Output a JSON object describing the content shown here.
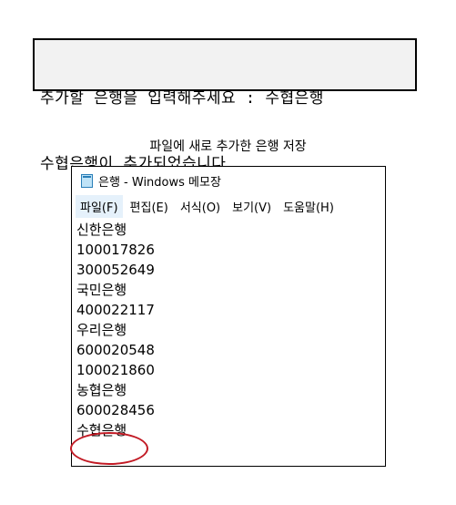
{
  "console": {
    "lines": [
      "추가할 은행을 입력해주세요 : 수협은행",
      "수협은행이 추가되었습니다."
    ]
  },
  "caption": "파일에 새로 추가한 은행 저장",
  "notepad": {
    "title": "은행 - Windows 메모장",
    "icon": "notepad-icon",
    "menu": [
      "파일(F)",
      "편집(E)",
      "서식(O)",
      "보기(V)",
      "도움말(H)"
    ],
    "lines": [
      "신한은행",
      "100017826",
      "300052649",
      "국민은행",
      "400022117",
      "우리은행",
      "600020548",
      "100021860",
      "농협은행",
      "600028456",
      "수협은행"
    ],
    "highlight_color": "#c21a24"
  }
}
